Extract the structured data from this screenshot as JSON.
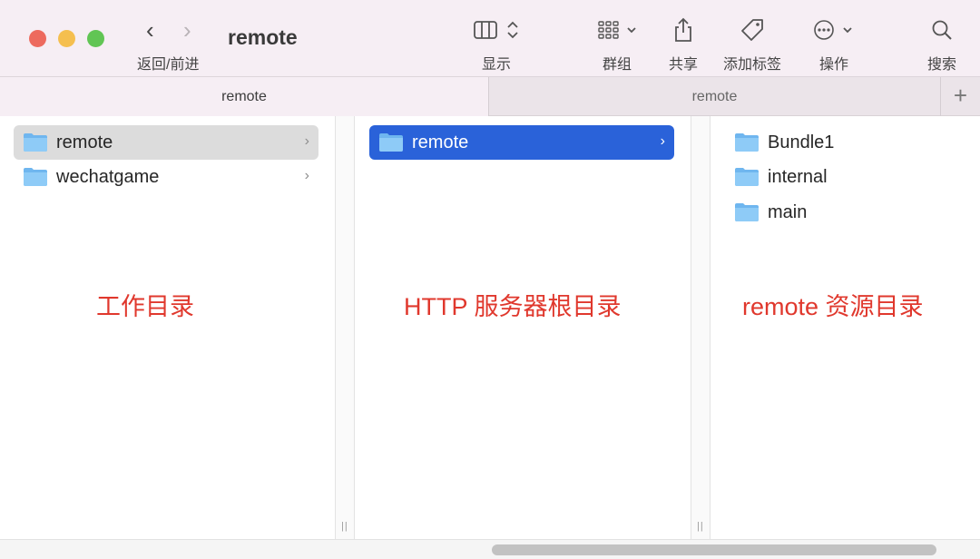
{
  "window": {
    "title": "remote"
  },
  "nav": {
    "back_glyph": "‹",
    "forward_glyph": "›",
    "label": "返回/前进"
  },
  "toolbar": {
    "view": "显示",
    "group": "群组",
    "share": "共享",
    "tags": "添加标签",
    "action": "操作",
    "search": "搜索"
  },
  "tabs": [
    {
      "label": "remote",
      "active": true
    },
    {
      "label": "remote",
      "active": false
    }
  ],
  "tab_add": "+",
  "columns": [
    {
      "items": [
        {
          "name": "remote",
          "has_children": true,
          "selected": "inactive"
        },
        {
          "name": "wechatgame",
          "has_children": true,
          "selected": "none"
        }
      ],
      "annotation": "工作目录"
    },
    {
      "items": [
        {
          "name": "remote",
          "has_children": true,
          "selected": "active"
        }
      ],
      "annotation": "HTTP 服务器根目录"
    },
    {
      "items": [
        {
          "name": "Bundle1",
          "has_children": false
        },
        {
          "name": "internal",
          "has_children": false
        },
        {
          "name": "main",
          "has_children": false
        }
      ],
      "annotation": "remote 资源目录"
    }
  ],
  "chevron_glyph": "›",
  "grip_glyph": "||",
  "colors": {
    "toolbar_bg": "#f6eef4",
    "selection_blue": "#2a62d9",
    "selection_gray": "#dcdcdc",
    "annotation_red": "#e0382d",
    "folder_blue": "#6fb6ef"
  }
}
